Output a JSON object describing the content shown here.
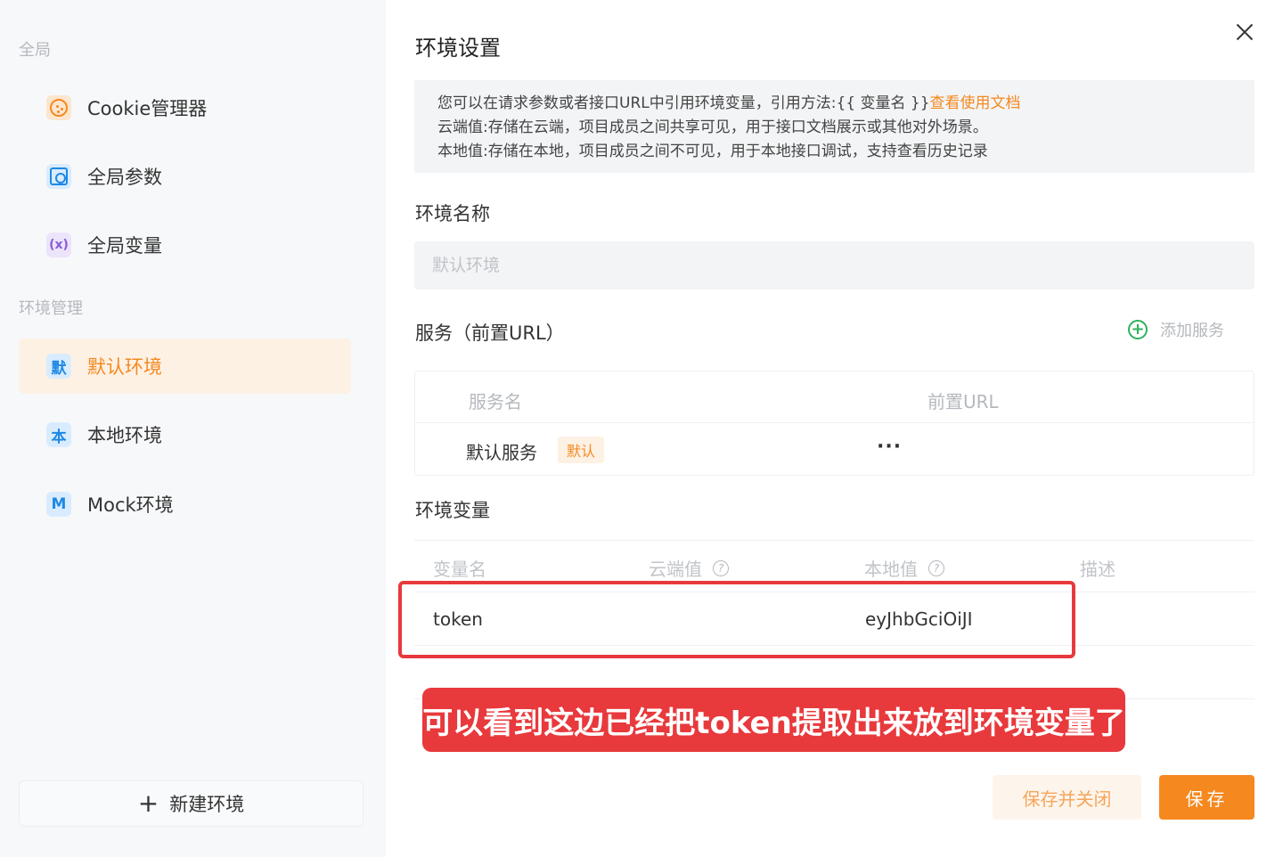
{
  "sidebar": {
    "section_global": "全局",
    "global_items": [
      {
        "label": "Cookie管理器",
        "icon": "cookie-icon"
      },
      {
        "label": "全局参数",
        "icon": "params-icon"
      },
      {
        "label": "全局变量",
        "icon": "variable-icon",
        "glyph": "(x)"
      }
    ],
    "section_env": "环境管理",
    "env_items": [
      {
        "label": "默认环境",
        "glyph": "默",
        "active": true
      },
      {
        "label": "本地环境",
        "glyph": "本",
        "active": false
      },
      {
        "label": "Mock环境",
        "glyph": "M",
        "active": false
      }
    ],
    "new_env_label": "新建环境",
    "new_env_glyph": "+"
  },
  "dialog": {
    "title": "环境设置",
    "close_glyph": "×",
    "notice": {
      "line1": "您可以在请求参数或者接口URL中引用环境变量，引用方法:{{ 变量名 }}",
      "line1_link": "查看使用文档",
      "line2": "云端值:存储在云端，项目成员之间共享可见，用于接口文档展示或其他对外场景。",
      "line3": "本地值:存储在本地，项目成员之间不可见，用于本地接口调试，支持查看历史记录"
    },
    "env_name_label": "环境名称",
    "env_name_placeholder": "默认环境",
    "service_label": "服务（前置URL）",
    "add_service_label": "添加服务",
    "service_table": {
      "headers": [
        "服务名",
        "前置URL"
      ],
      "rows": [
        {
          "name": "默认服务",
          "badge": "默认",
          "url": "",
          "more": "···"
        }
      ]
    },
    "env_var_label": "环境变量",
    "var_table": {
      "headers": [
        "变量名",
        "云端值",
        "本地值",
        "描述"
      ],
      "help_glyph": "?",
      "rows": [
        {
          "name": "token",
          "cloud": "",
          "local": "eyJhbGciOiJI",
          "desc": ""
        }
      ]
    },
    "annotation": "可以看到这边已经把token提取出来放到环境变量了",
    "save_close_label": "保存并关闭",
    "save_label": "保存"
  },
  "colors": {
    "accent": "#f5891f",
    "annotation": "#e8393c",
    "add_green": "#2fb35e"
  }
}
